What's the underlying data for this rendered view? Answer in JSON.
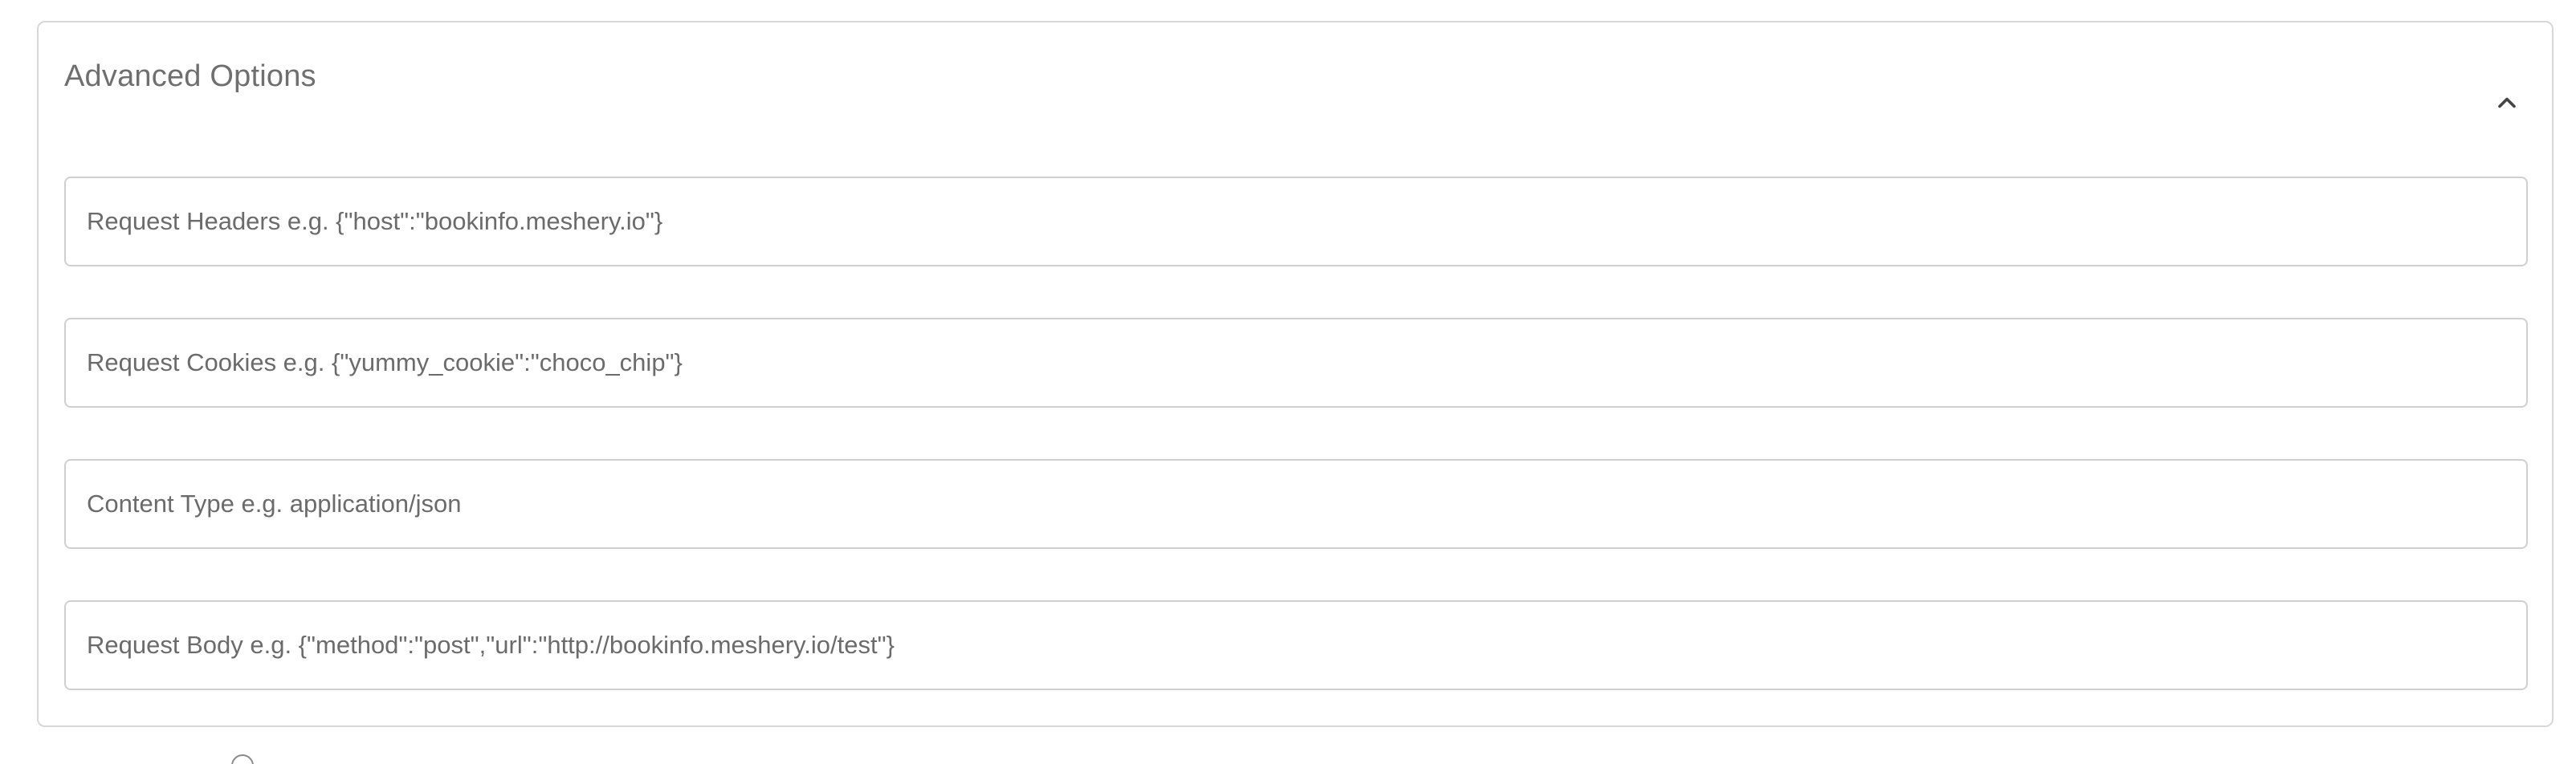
{
  "advanced_options": {
    "title": "Advanced Options",
    "expanded": true,
    "toggle_icon": "chevron-up-icon",
    "fields": [
      {
        "placeholder": "Request Headers e.g. {\"host\":\"bookinfo.meshery.io\"}",
        "value": ""
      },
      {
        "placeholder": "Request Cookies e.g. {\"yummy_cookie\":\"choco_chip\"}",
        "value": ""
      },
      {
        "placeholder": "Content Type e.g. application/json",
        "value": ""
      },
      {
        "placeholder": "Request Body e.g. {\"method\":\"post\",\"url\":\"http://bookinfo.meshery.io/test\"}",
        "value": ""
      }
    ]
  }
}
